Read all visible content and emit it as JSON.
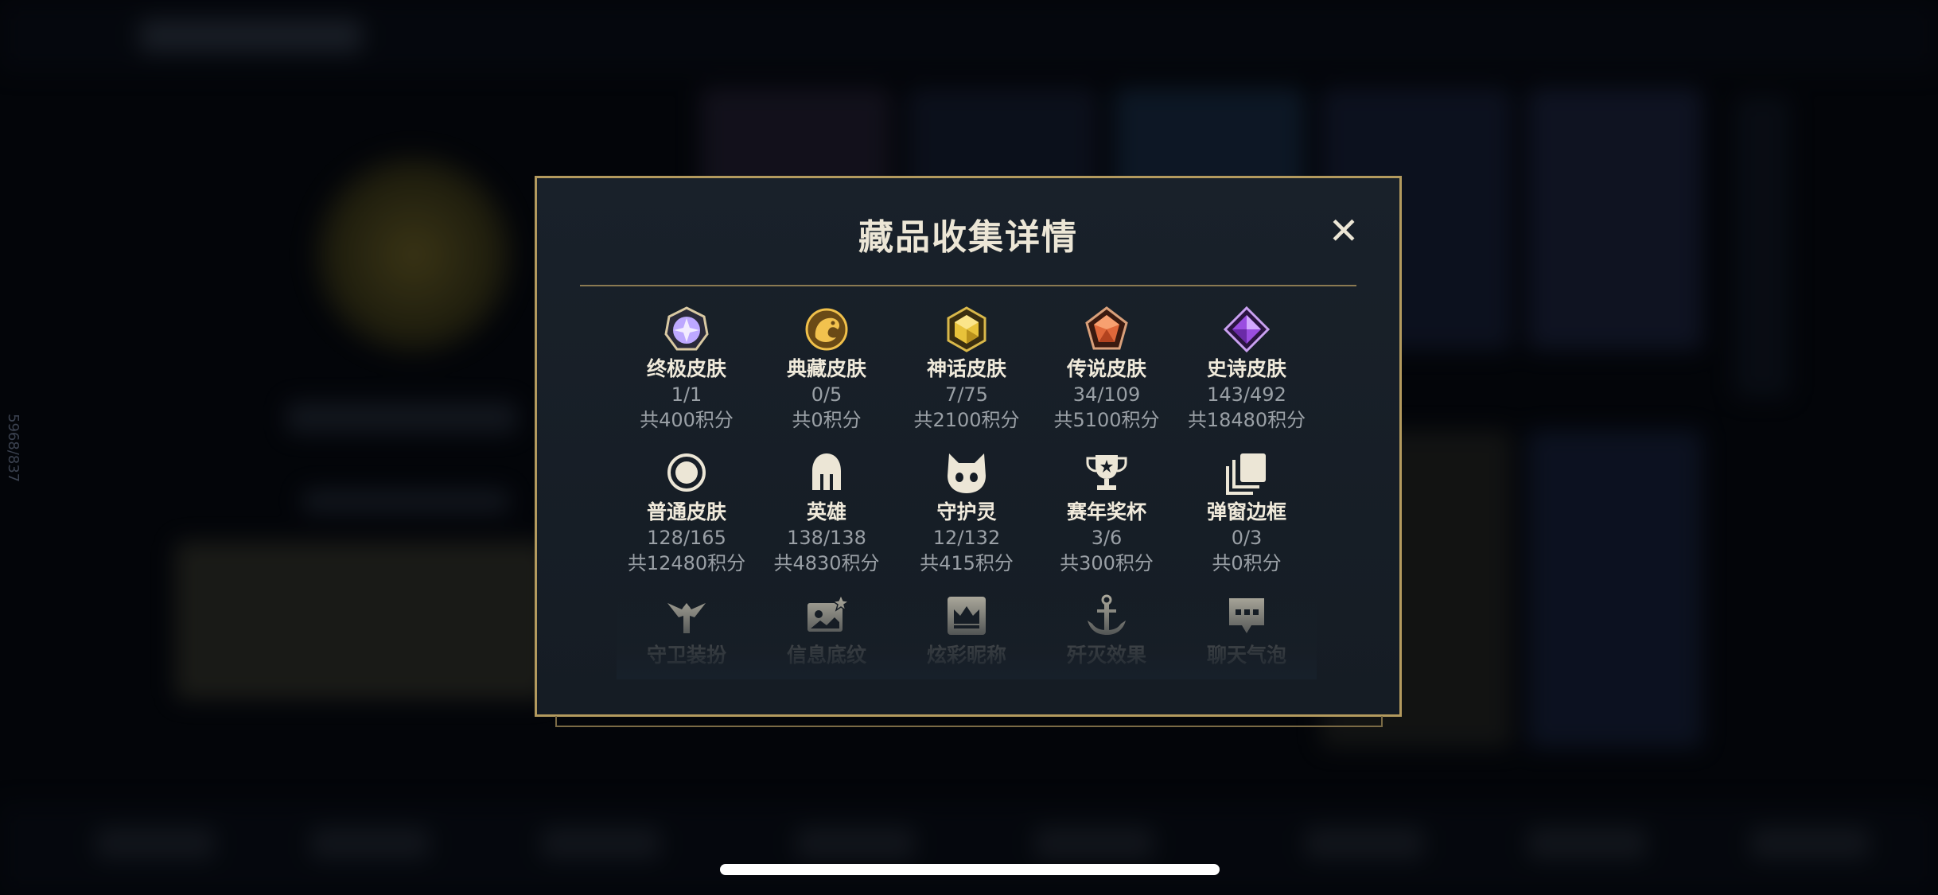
{
  "side_id": "5968/837",
  "modal": {
    "title": "藏品收集详情",
    "close_label": "✕"
  },
  "rows": [
    [
      {
        "label": "终极皮肤",
        "count": "1/1",
        "points": "共400积分",
        "icon": "ultimate-gem-icon",
        "color": "#c9b8ff"
      },
      {
        "label": "典藏皮肤",
        "count": "0/5",
        "points": "共0积分",
        "icon": "dragon-emblem-icon",
        "color": "#d8a640"
      },
      {
        "label": "神话皮肤",
        "count": "7/75",
        "points": "共2100积分",
        "icon": "mythic-gem-icon",
        "color": "#e8c23a"
      },
      {
        "label": "传说皮肤",
        "count": "34/109",
        "points": "共5100积分",
        "icon": "legendary-gem-icon",
        "color": "#e0683a"
      },
      {
        "label": "史诗皮肤",
        "count": "143/492",
        "points": "共18480积分",
        "icon": "epic-gem-icon",
        "color": "#9a4de0"
      }
    ],
    [
      {
        "label": "普通皮肤",
        "count": "128/165",
        "points": "共12480积分",
        "icon": "ring-icon",
        "color": "#ece6d6"
      },
      {
        "label": "英雄",
        "count": "138/138",
        "points": "共4830积分",
        "icon": "helmet-icon",
        "color": "#ece6d6"
      },
      {
        "label": "守护灵",
        "count": "12/132",
        "points": "共415积分",
        "icon": "cat-face-icon",
        "color": "#ece6d6"
      },
      {
        "label": "赛年奖杯",
        "count": "3/6",
        "points": "共300积分",
        "icon": "trophy-icon",
        "color": "#ece6d6"
      },
      {
        "label": "弹窗边框",
        "count": "0/3",
        "points": "共0积分",
        "icon": "stacked-frames-icon",
        "color": "#ece6d6"
      }
    ],
    [
      {
        "label": "守卫装扮",
        "icon": "ward-icon",
        "color": "#ece6d6"
      },
      {
        "label": "信息底纹",
        "icon": "picture-sparkle-icon",
        "color": "#ece6d6"
      },
      {
        "label": "炫彩昵称",
        "icon": "crown-card-icon",
        "color": "#ece6d6"
      },
      {
        "label": "歼灭效果",
        "icon": "anchor-icon",
        "color": "#ece6d6"
      },
      {
        "label": "聊天气泡",
        "icon": "chat-bubble-icon",
        "color": "#ece6d6"
      }
    ]
  ]
}
